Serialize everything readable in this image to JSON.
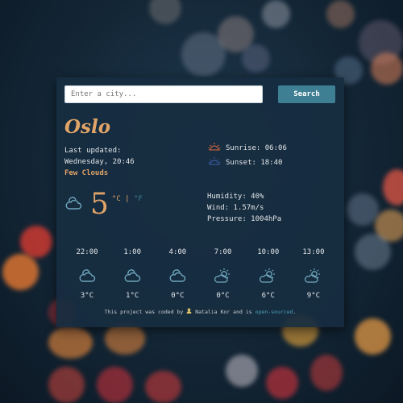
{
  "search": {
    "placeholder": "Enter a city...",
    "value": "",
    "button_label": "Search"
  },
  "current": {
    "city": "Oslo",
    "updated_label": "Last updated:",
    "updated_time": "Wednesday, 20:46",
    "description": "Few Clouds",
    "temperature": "5",
    "unit_c": "°C",
    "unit_sep": "|",
    "unit_f": "°F",
    "icon": "cloud-icon"
  },
  "sun": {
    "sunrise": "Sunrise: 06:06",
    "sunset": "Sunset: 18:40"
  },
  "details": {
    "humidity": "Humidity: 40%",
    "wind": "Wind: 1.57m/s",
    "pressure": "Pressure: 1004hPa"
  },
  "forecast": [
    {
      "time": "22:00",
      "icon": "cloud-icon",
      "temp": "3°C"
    },
    {
      "time": "1:00",
      "icon": "cloud-icon",
      "temp": "1°C"
    },
    {
      "time": "4:00",
      "icon": "cloud-icon",
      "temp": "0°C"
    },
    {
      "time": "7:00",
      "icon": "partly-sunny-icon",
      "temp": "0°C"
    },
    {
      "time": "10:00",
      "icon": "partly-sunny-icon",
      "temp": "6°C"
    },
    {
      "time": "13:00",
      "icon": "partly-sunny-icon",
      "temp": "9°C"
    }
  ],
  "footer": {
    "prefix": "This project was coded by",
    "author": "Natalia Kor",
    "middle": "and is",
    "link": "open-sourced",
    "suffix": "."
  },
  "colors": {
    "accent": "#e0a468",
    "button": "#3f7f94",
    "card": "#172c40",
    "link": "#4f9fb8"
  }
}
